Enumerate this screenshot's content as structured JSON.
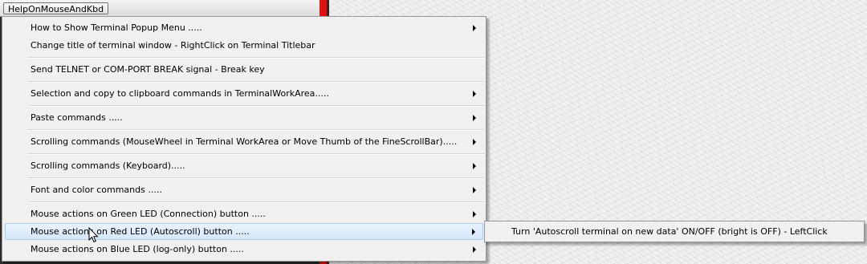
{
  "toolbar": {
    "help_button": "HelpOnMouseAndKbd"
  },
  "menu": {
    "items": [
      {
        "label": "How to Show Terminal Popup Menu .....",
        "submenu": true
      },
      {
        "label": "Change title of terminal window - RightClick on Terminal Titlebar",
        "submenu": false
      },
      {
        "label": "Send TELNET or COM-PORT BREAK signal - Break key",
        "submenu": false
      },
      {
        "label": "Selection and copy to clipboard commands in TerminalWorkArea.....",
        "submenu": true
      },
      {
        "label": "Paste commands .....",
        "submenu": true
      },
      {
        "label": "Scrolling commands (MouseWheel in Terminal WorkArea or Move Thumb of the FineScrollBar).....",
        "submenu": true
      },
      {
        "label": "Scrolling commands (Keyboard).....",
        "submenu": true
      },
      {
        "label": "Font and color commands .....",
        "submenu": true
      },
      {
        "label": "Mouse actions on Green LED (Connection) button .....",
        "submenu": true
      },
      {
        "label": "Mouse actions on Red LED (Autoscroll) button .....",
        "submenu": true,
        "highlighted": true
      },
      {
        "label": "Mouse actions on Blue LED (log-only) button .....",
        "submenu": true
      }
    ]
  },
  "submenu": {
    "items": [
      {
        "label": "Turn 'Autoscroll terminal on new data' ON/OFF (bright is OFF) - LeftClick"
      }
    ]
  },
  "colors": {
    "red_stripe": "#e51010",
    "highlight": "#d6e8fa",
    "menu_bg": "#f0f0f0"
  }
}
